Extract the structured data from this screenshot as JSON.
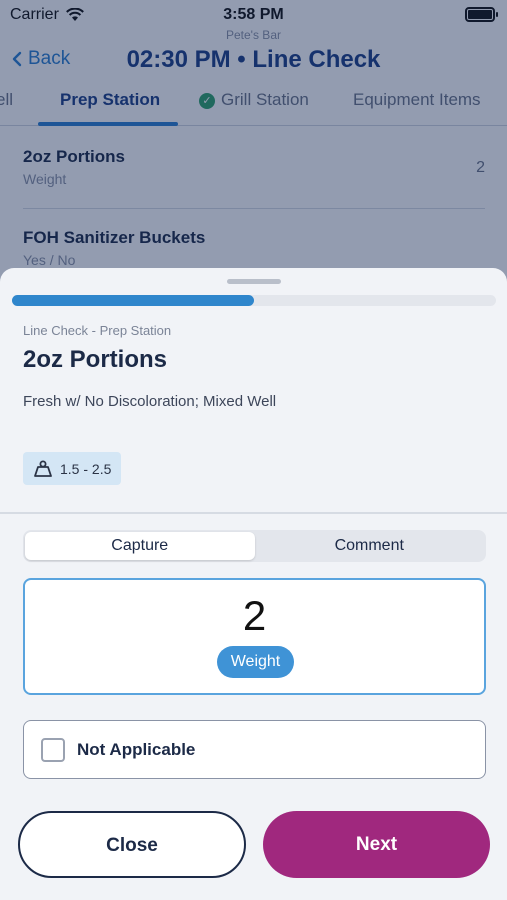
{
  "status_bar": {
    "carrier": "Carrier",
    "time": "3:58 PM"
  },
  "header": {
    "subtitle": "Pete's Bar",
    "back_label": "Back",
    "title": "02:30 PM • Line Check"
  },
  "tabs": [
    {
      "label": "ell"
    },
    {
      "label": "Prep Station"
    },
    {
      "label": "Grill Station"
    },
    {
      "label": "Equipment Items"
    }
  ],
  "list": [
    {
      "title": "2oz Portions",
      "subtitle": "Weight",
      "value": "2"
    },
    {
      "title": "FOH Sanitizer Buckets",
      "subtitle": "Yes / No"
    }
  ],
  "sheet": {
    "progress": 0.5,
    "breadcrumb": "Line Check - Prep Station",
    "item_title": "2oz Portions",
    "description": "Fresh w/ No Discoloration; Mixed Well",
    "range": "1.5 - 2.5",
    "segments": {
      "capture": "Capture",
      "comment": "Comment"
    },
    "captured_value": "2",
    "unit_label": "Weight",
    "not_applicable_label": "Not Applicable",
    "close_label": "Close",
    "next_label": "Next"
  },
  "colors": {
    "accent": "#2f86cc",
    "next_button": "#a0287e",
    "title_blue": "#1d3f86",
    "success": "#2fa36b"
  },
  "icons": [
    "wifi-icon",
    "battery-icon",
    "chevron-left-icon",
    "check-circle-icon",
    "weight-scale-icon",
    "checkbox-icon"
  ]
}
